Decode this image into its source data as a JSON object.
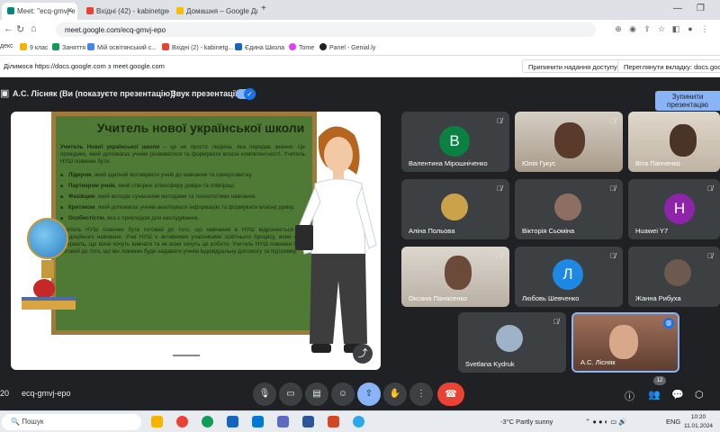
{
  "browser": {
    "tabs": [
      {
        "title": "Meet: \"ecq-gmvj-e",
        "active": true,
        "favicon_color": "#00897b"
      },
      {
        "title": "Вхідні (42) - kabinetgeogr",
        "active": false,
        "favicon_color": "#ea4335"
      },
      {
        "title": "Домашня – Google Диск",
        "active": false,
        "favicon_color": "#fbbc04"
      }
    ],
    "url": "meet.google.com/ecq-gmvj-epo",
    "bookmarks": [
      {
        "label": "декс",
        "color": "#fc3f1d"
      },
      {
        "label": "9 клас",
        "color": "#f4b400"
      },
      {
        "label": "Заняття",
        "color": "#0f9d58"
      },
      {
        "label": "Мій освітянський с...",
        "color": "#4285f4"
      },
      {
        "label": "Вхідні (2) - kabinetg...",
        "color": "#ea4335"
      },
      {
        "label": "Єдина Школа",
        "color": "#1565c0"
      },
      {
        "label": "Tome",
        "color": "#e040fb"
      },
      {
        "label": "Panel - Genial.ly",
        "color": "#202124"
      }
    ],
    "share_notice": "Ділимося https://docs.google.com з meet.google.com",
    "stop_sharing": "Припинити надання доступу",
    "view_tab": "Переглянути вкладку: docs.google.com"
  },
  "meet": {
    "presenter": "А.С. Лісняк (Ви (показуєте презентацію))",
    "sound_label": "Звук презентації",
    "stop_presentation": "Зупинити презентацію",
    "meeting_code": "ecq-gmvj-epo",
    "time_fragment": "20",
    "people_count": "12"
  },
  "slide": {
    "title": "Учитель нової української школи",
    "intro_bold": "Учитель Нової української школи",
    "intro_text": " – це не просто людина, яка передає знання. Це провідник, який допомагає учням розвиватися та формувати власні компетентності. Учитель НУШ повинен бути:",
    "items": [
      {
        "bold": "Лідером",
        "text": ", який здатний мотивувати учнів до навчання та саморозвитку."
      },
      {
        "bold": "Партнером учнів",
        "text": ", який створює атмосферу довіри та співпраці."
      },
      {
        "bold": "Фахівцем",
        "text": ", який володіє сучасними методами та технологіями навчання."
      },
      {
        "bold": "Критиком",
        "text": ", який допомагає учням аналізувати інформацію та формувати власну думку."
      },
      {
        "bold": "Особистістю",
        "text": ", яка є прикладом для наслідування."
      }
    ],
    "outro": "Учитель НУШ повинен бути готовий до того, що навчання в НУШ відрізняється від традиційного навчання. Учні НУШ є активними учасниками освітнього процесу, вони самі обирають, що вони хочуть вивчати та як вони хочуть це робити. Учитель НУШ повинен бути готовий до того, що він повинен буде надавати учням індивідуальну допомогу та підтримку."
  },
  "participants": [
    {
      "name": "Валентина Мірошніченко",
      "avatar_letter": "В",
      "avatar_color": "#0b8043",
      "type": "letter"
    },
    {
      "name": "Юлія Гукус",
      "type": "video",
      "bg": "#b7a99a"
    },
    {
      "name": "Віта Панченко",
      "type": "video",
      "bg": "#cfc4b5"
    },
    {
      "name": "Аліна Польова",
      "type": "photo",
      "bg": "#c9a24a"
    },
    {
      "name": "Вікторія Сьоміна",
      "type": "photo",
      "bg": "#8d6e63"
    },
    {
      "name": "Huawei Y7",
      "avatar_letter": "H",
      "avatar_color": "#8e24aa",
      "type": "letter"
    },
    {
      "name": "Оксана Панасенко",
      "type": "video",
      "bg": "#c8c2b8"
    },
    {
      "name": "Любовь Шевченко",
      "avatar_letter": "Л",
      "avatar_color": "#1e88e5",
      "type": "letter"
    },
    {
      "name": "Жанна Рибуха",
      "type": "photo",
      "bg": "#6d5a4f"
    },
    {
      "name": "Svetlana Kydruk",
      "type": "photo",
      "bg": "#9fb3c8"
    },
    {
      "name": "А.С. Лісняк",
      "type": "video",
      "bg": "#7a5646"
    }
  ],
  "taskbar": {
    "search_placeholder": "Пошук",
    "weather": "-3°C  Partly sunny",
    "lang": "ENG",
    "time": "10:20",
    "date": "11.01.2024"
  }
}
